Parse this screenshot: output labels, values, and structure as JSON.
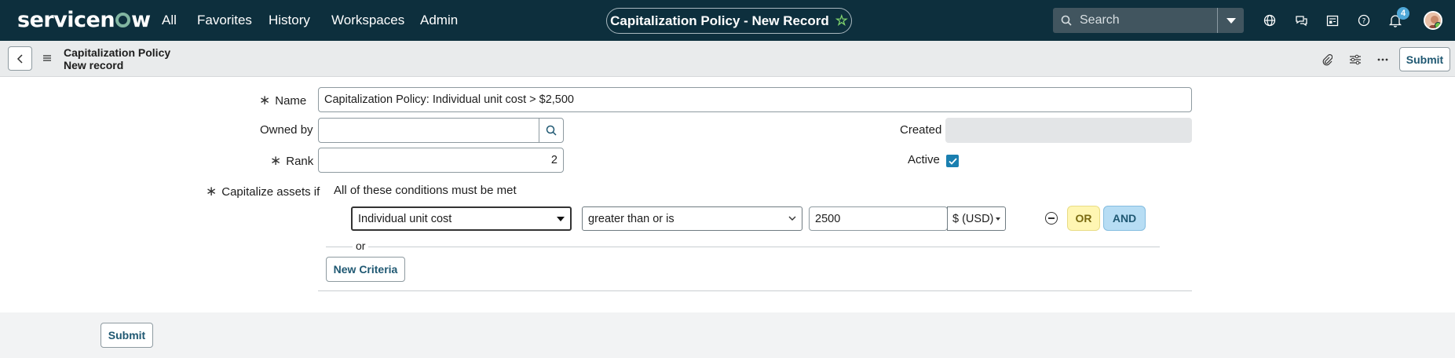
{
  "topnav": {
    "logo": "servicenow",
    "items": [
      "All",
      "Favorites",
      "History",
      "Workspaces",
      "Admin"
    ],
    "record_title": "Capitalization Policy - New Record",
    "search_placeholder": "Search",
    "notification_count": "4",
    "icons": [
      "globe-icon",
      "chat-icon",
      "newspaper-icon",
      "help-icon",
      "bell-icon"
    ]
  },
  "subheader": {
    "table_name": "Capitalization Policy",
    "record_state": "New record",
    "submit_label": "Submit",
    "icons": [
      "paperclip-icon",
      "sliders-icon",
      "more-icon"
    ]
  },
  "form": {
    "name": {
      "label": "Name",
      "value": "Capitalization Policy: Individual unit cost > $2,500"
    },
    "owned_by": {
      "label": "Owned by",
      "value": ""
    },
    "created": {
      "label": "Created",
      "value": ""
    },
    "rank": {
      "label": "Rank",
      "value": "2"
    },
    "active": {
      "label": "Active",
      "checked": true
    },
    "condition": {
      "label": "Capitalize assets if",
      "summary": "All of these conditions must be met",
      "field": "Individual unit cost",
      "operator": "greater than or is",
      "value": "2500",
      "currency": "$ (USD)",
      "or_label": "OR",
      "and_label": "AND",
      "or_separator": "or",
      "new_criteria_label": "New Criteria"
    }
  },
  "footer": {
    "submit_label": "Submit"
  }
}
